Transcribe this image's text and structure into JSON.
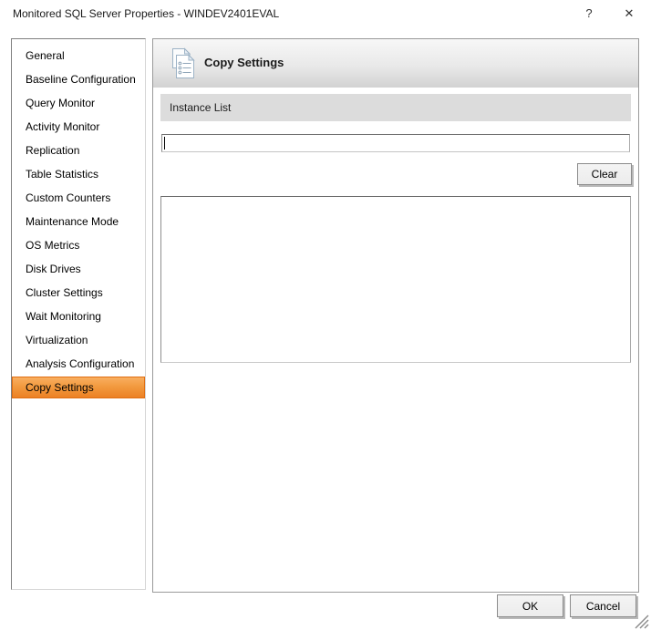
{
  "window": {
    "title": "Monitored SQL Server Properties - WINDEV2401EVAL",
    "help_icon": "?",
    "close_icon": "✕"
  },
  "sidebar": {
    "items": [
      {
        "label": "General",
        "selected": false
      },
      {
        "label": "Baseline Configuration",
        "selected": false
      },
      {
        "label": "Query Monitor",
        "selected": false
      },
      {
        "label": "Activity Monitor",
        "selected": false
      },
      {
        "label": "Replication",
        "selected": false
      },
      {
        "label": "Table Statistics",
        "selected": false
      },
      {
        "label": "Custom Counters",
        "selected": false
      },
      {
        "label": "Maintenance Mode",
        "selected": false
      },
      {
        "label": "OS Metrics",
        "selected": false
      },
      {
        "label": "Disk Drives",
        "selected": false
      },
      {
        "label": "Cluster Settings",
        "selected": false
      },
      {
        "label": "Wait Monitoring",
        "selected": false
      },
      {
        "label": "Virtualization",
        "selected": false
      },
      {
        "label": "Analysis Configuration",
        "selected": false
      },
      {
        "label": "Copy Settings",
        "selected": true
      }
    ]
  },
  "main": {
    "header": {
      "title": "Copy Settings",
      "icon": "copy-pages-icon"
    },
    "section_title": "Instance List",
    "filter_input": {
      "value": "",
      "placeholder": "",
      "focused": true
    },
    "clear_button_label": "Clear",
    "instance_list_items": []
  },
  "footer": {
    "ok_button_label": "OK",
    "cancel_button_label": "Cancel"
  },
  "colors": {
    "selected_item_top": "#f9ae60",
    "selected_item_bottom": "#ec8124",
    "selected_item_border": "#e06e12",
    "section_bar_bg": "#dcdcdc",
    "header_gradient_top": "#f7f7f7",
    "header_gradient_bottom": "#d2d2d2",
    "panel_border": "#9a9a9a"
  }
}
